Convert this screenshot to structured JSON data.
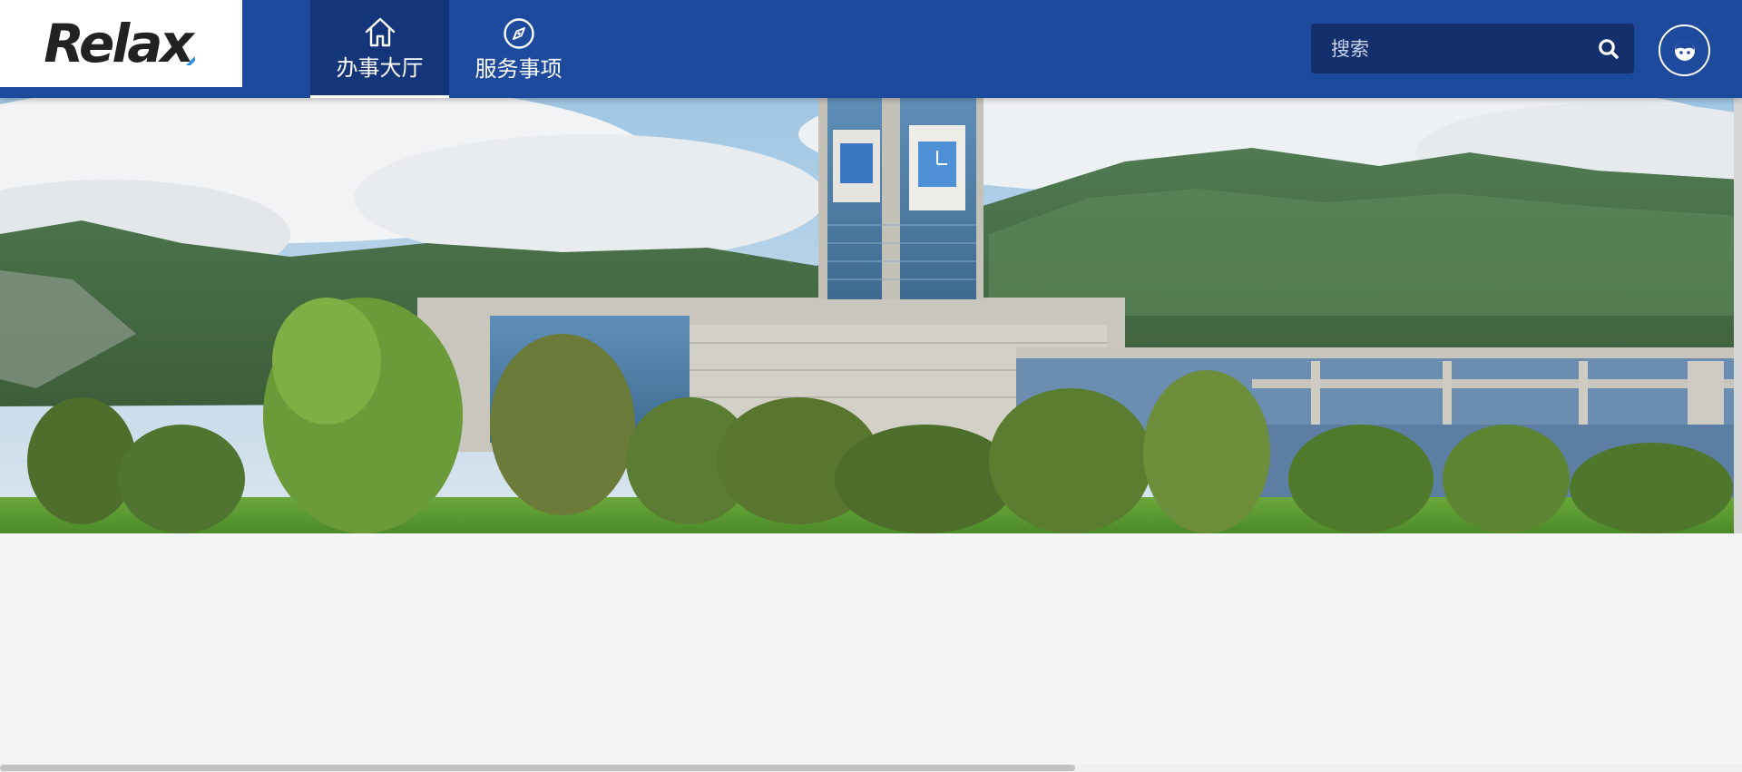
{
  "logo": {
    "text": "Relax"
  },
  "nav": {
    "items": [
      {
        "label": "办事大厅",
        "icon": "home-icon",
        "active": true
      },
      {
        "label": "服务事项",
        "icon": "compass-icon",
        "active": false
      }
    ]
  },
  "search": {
    "placeholder": "搜索",
    "value": ""
  },
  "user": {
    "avatar_icon": "user-avatar-icon"
  },
  "banner": {
    "image": "government-building-mountain-photo"
  },
  "colors": {
    "header_bg": "#1d4a9c",
    "nav_active_bg": "#15357a",
    "search_bg": "#14306c",
    "logo_accent": "#2b8ee0",
    "page_bg": "#f5f5f5"
  }
}
